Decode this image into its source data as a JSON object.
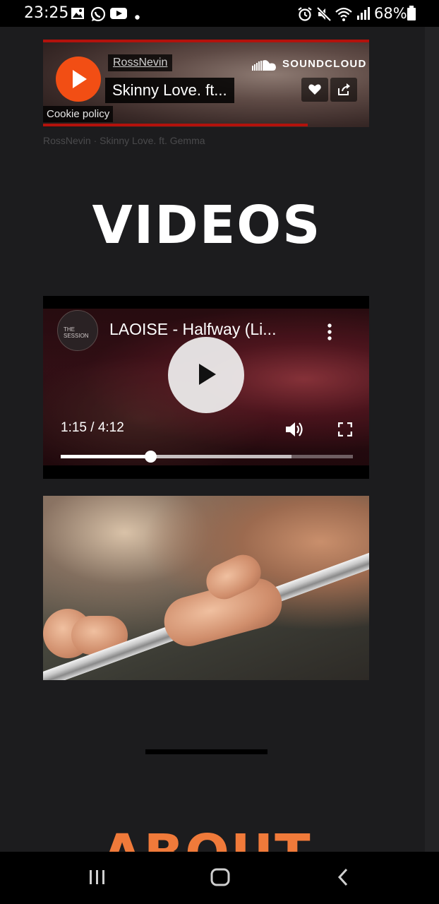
{
  "status_bar": {
    "time": "23:25",
    "battery": "68%",
    "icons": [
      "gallery-icon",
      "whatsapp-icon",
      "youtube-icon",
      "dot-icon",
      "alarm-icon",
      "mute-icon",
      "wifi-icon",
      "signal-icon",
      "battery-icon"
    ]
  },
  "soundcloud": {
    "username": "RossNevin",
    "track_title": "Skinny Love. ft...",
    "brand": "SOUNDCLOUD",
    "cookie_policy": "Cookie policy",
    "caption": "RossNevin · Skinny Love. ft. Gemma",
    "accent_color": "#f24e14",
    "progress_color": "#b3120c"
  },
  "videos_section": {
    "heading": "VIDEOS"
  },
  "video_player": {
    "title": "LAOISE - Halfway (Li...",
    "time_display": "1:15 / 4:12",
    "played_fraction": 0.307,
    "buffered_fraction": 0.79
  },
  "about_section": {
    "heading": "ABOUT",
    "color": "#f07a3a"
  },
  "nav_bar": {
    "buttons": [
      "recent-apps-icon",
      "home-icon",
      "back-icon"
    ]
  }
}
